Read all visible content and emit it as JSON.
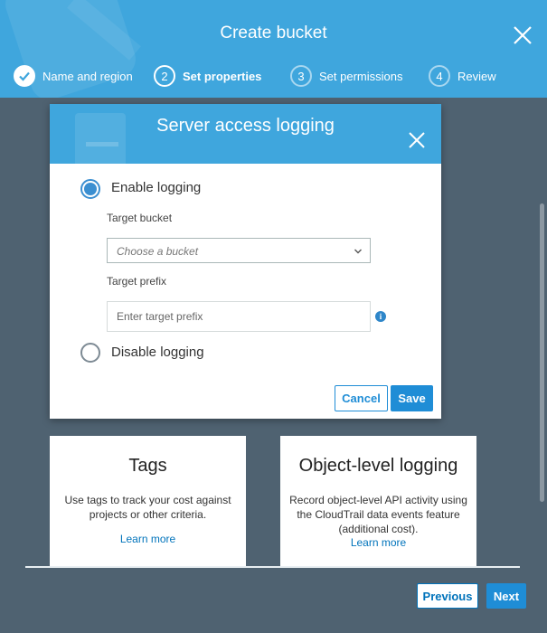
{
  "wizard": {
    "title": "Create bucket",
    "steps": [
      {
        "number": "",
        "label": "Name and region",
        "state": "done"
      },
      {
        "number": "2",
        "label": "Set properties",
        "state": "active"
      },
      {
        "number": "3",
        "label": "Set permissions",
        "state": "pending"
      },
      {
        "number": "4",
        "label": "Review",
        "state": "pending"
      }
    ]
  },
  "modal": {
    "title": "Server access logging",
    "enable_label": "Enable logging",
    "disable_label": "Disable logging",
    "selected_option": "Enable logging",
    "target_bucket_label": "Target bucket",
    "target_bucket_placeholder": "Choose a bucket",
    "target_prefix_label": "Target prefix",
    "target_prefix_placeholder": "Enter target prefix",
    "info_symbol": "i",
    "cancel_label": "Cancel",
    "save_label": "Save"
  },
  "cards": {
    "tags": {
      "title": "Tags",
      "description": "Use tags to track your cost against projects or other criteria.",
      "link": "Learn more"
    },
    "object_logging": {
      "title": "Object-level logging",
      "description": "Record object-level API activity using the CloudTrail data events feature (additional cost).",
      "link": "Learn more"
    }
  },
  "footer": {
    "previous_label": "Previous",
    "next_label": "Next"
  },
  "colors": {
    "header_blue": "#3fa6dd",
    "backdrop": "#4f6271",
    "primary_button": "#1f8dd6",
    "link": "#0073bb"
  }
}
